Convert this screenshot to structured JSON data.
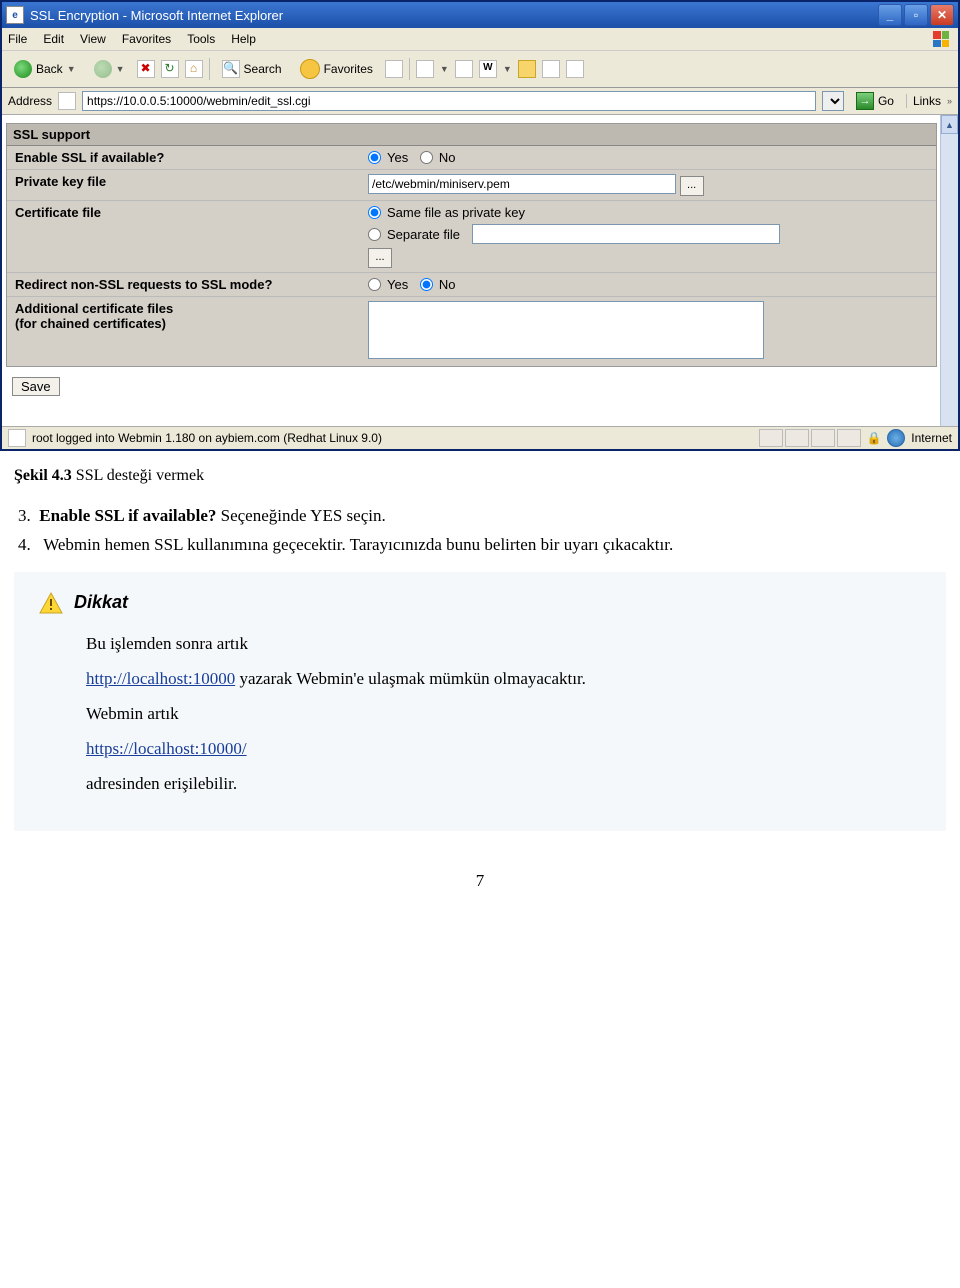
{
  "ie": {
    "title": "SSL Encryption - Microsoft Internet Explorer",
    "menu": {
      "file": "File",
      "edit": "Edit",
      "view": "View",
      "favorites": "Favorites",
      "tools": "Tools",
      "help": "Help"
    },
    "toolbar": {
      "back": "Back",
      "search": "Search",
      "favorites": "Favorites"
    },
    "address_label": "Address",
    "address_value": "https://10.0.0.5:10000/webmin/edit_ssl.cgi",
    "go": "Go",
    "links": "Links",
    "status_left": "root logged into Webmin 1.180 on aybiem.com (Redhat Linux 9.0)",
    "status_zone": "Internet"
  },
  "form": {
    "panel_title": "SSL support",
    "enable_label": "Enable SSL if available?",
    "yes": "Yes",
    "no": "No",
    "pkey_label": "Private key file",
    "pkey_value": "/etc/webmin/miniserv.pem",
    "cert_label": "Certificate file",
    "cert_same": "Same file as private key",
    "cert_sep": "Separate file",
    "redirect_label": "Redirect non-SSL requests to SSL mode?",
    "addl_label": "Additional certificate files\n(for chained certificates)",
    "save": "Save"
  },
  "doc": {
    "caption_prefix": "Şekil 4.3 ",
    "caption_text": "SSL desteği vermek",
    "item3_prefix": "3.",
    "item3_bold": "Enable SSL if available?",
    "item3_rest": " Seçeneğinde YES seçin.",
    "item4_prefix": "4.",
    "item4_text": " Webmin hemen SSL kullanımına geçecektir. Tarayıcınızda bunu belirten bir uyarı çıkacaktır.",
    "notice_title": "Dikkat",
    "p1": "Bu işlemden sonra artık",
    "link1": "http://localhost:10000",
    "p2_rest": " yazarak Webmin'e ulaşmak mümkün olmayacaktır.",
    "p3": "Webmin artık",
    "link2": "https://localhost:10000/",
    "p4": "adresinden erişilebilir.",
    "page": "7"
  }
}
